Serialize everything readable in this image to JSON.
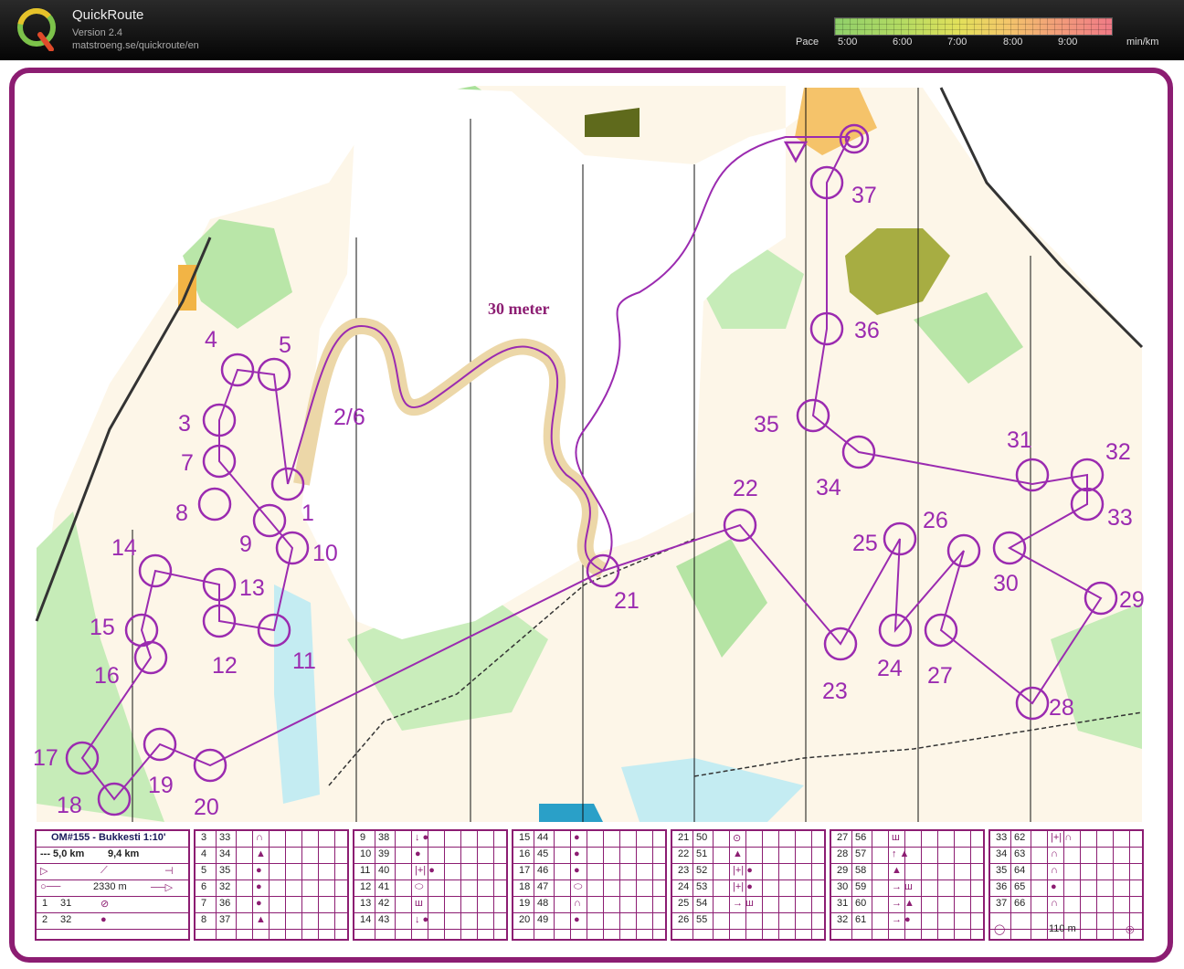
{
  "app": {
    "title": "QuickRoute",
    "version": "Version 2.4",
    "url": "matstroeng.se/quickroute/en"
  },
  "pace": {
    "label": "Pace",
    "ticks": [
      "5:00",
      "6:00",
      "7:00",
      "8:00",
      "9:00"
    ],
    "unit": "min/km"
  },
  "map": {
    "label_30m": "30 meter",
    "controls": [
      {
        "n": "1",
        "label": "1"
      },
      {
        "n": "2/6",
        "label": "2/6"
      },
      {
        "n": "3",
        "label": "3"
      },
      {
        "n": "4",
        "label": "4"
      },
      {
        "n": "5",
        "label": "5"
      },
      {
        "n": "7",
        "label": "7"
      },
      {
        "n": "8",
        "label": "8"
      },
      {
        "n": "9",
        "label": "9"
      },
      {
        "n": "10",
        "label": "10"
      },
      {
        "n": "11",
        "label": "11"
      },
      {
        "n": "12",
        "label": "12"
      },
      {
        "n": "13",
        "label": "13"
      },
      {
        "n": "14",
        "label": "14"
      },
      {
        "n": "15",
        "label": "15"
      },
      {
        "n": "16",
        "label": "16"
      },
      {
        "n": "17",
        "label": "17"
      },
      {
        "n": "18",
        "label": "18"
      },
      {
        "n": "19",
        "label": "19"
      },
      {
        "n": "20",
        "label": "20"
      },
      {
        "n": "21",
        "label": "21"
      },
      {
        "n": "22",
        "label": "22"
      },
      {
        "n": "23",
        "label": "23"
      },
      {
        "n": "24",
        "label": "24"
      },
      {
        "n": "25",
        "label": "25"
      },
      {
        "n": "26",
        "label": "26"
      },
      {
        "n": "27",
        "label": "27"
      },
      {
        "n": "28",
        "label": "28"
      },
      {
        "n": "29",
        "label": "29"
      },
      {
        "n": "30",
        "label": "30"
      },
      {
        "n": "31",
        "label": "31"
      },
      {
        "n": "32",
        "label": "32"
      },
      {
        "n": "33",
        "label": "33"
      },
      {
        "n": "34",
        "label": "34"
      },
      {
        "n": "35",
        "label": "35"
      },
      {
        "n": "36",
        "label": "36"
      },
      {
        "n": "37",
        "label": "37"
      }
    ]
  },
  "description": {
    "title": "OM#155 - Bukkesti 1:10'",
    "dist1": "--- 5,0 km",
    "dist2": "9,4 km",
    "leg_length": "2330 m",
    "finish_length": "110 m",
    "columns": [
      [
        [
          "1",
          "31",
          "sym-rock"
        ],
        [
          "2",
          "32",
          "●"
        ]
      ],
      [
        [
          "3",
          "33",
          "∩"
        ],
        [
          "4",
          "34",
          "▲"
        ],
        [
          "5",
          "35",
          "●"
        ],
        [
          "6",
          "32",
          "●"
        ],
        [
          "7",
          "36",
          "●"
        ],
        [
          "8",
          "37",
          "▲"
        ]
      ],
      [
        [
          "9",
          "38",
          "↓ ●"
        ],
        [
          "10",
          "39",
          "●"
        ],
        [
          "11",
          "40",
          "|+| ●"
        ],
        [
          "12",
          "41",
          "⬭"
        ],
        [
          "13",
          "42",
          "ш"
        ],
        [
          "14",
          "43",
          "↓ ●"
        ]
      ],
      [
        [
          "15",
          "44",
          "●"
        ],
        [
          "16",
          "45",
          "●"
        ],
        [
          "17",
          "46",
          "●"
        ],
        [
          "18",
          "47",
          "⬭"
        ],
        [
          "19",
          "48",
          "∩"
        ],
        [
          "20",
          "49",
          "●"
        ]
      ],
      [
        [
          "21",
          "50",
          "⊙"
        ],
        [
          "22",
          "51",
          "▲"
        ],
        [
          "23",
          "52",
          "|+| ●"
        ],
        [
          "24",
          "53",
          "|+| ●"
        ],
        [
          "25",
          "54",
          "→ ш"
        ],
        [
          "26",
          "55",
          ""
        ]
      ],
      [
        [
          "27",
          "56",
          "ш"
        ],
        [
          "28",
          "57",
          "↑ ▲"
        ],
        [
          "29",
          "58",
          "▲"
        ],
        [
          "30",
          "59",
          "→ ш"
        ],
        [
          "31",
          "60",
          "→ ▲"
        ],
        [
          "32",
          "61",
          "→ ●"
        ]
      ],
      [
        [
          "33",
          "62",
          "|+| ∩"
        ],
        [
          "34",
          "63",
          "∩"
        ],
        [
          "35",
          "64",
          "∩"
        ],
        [
          "36",
          "65",
          "●"
        ],
        [
          "37",
          "66",
          "∩"
        ]
      ]
    ]
  }
}
